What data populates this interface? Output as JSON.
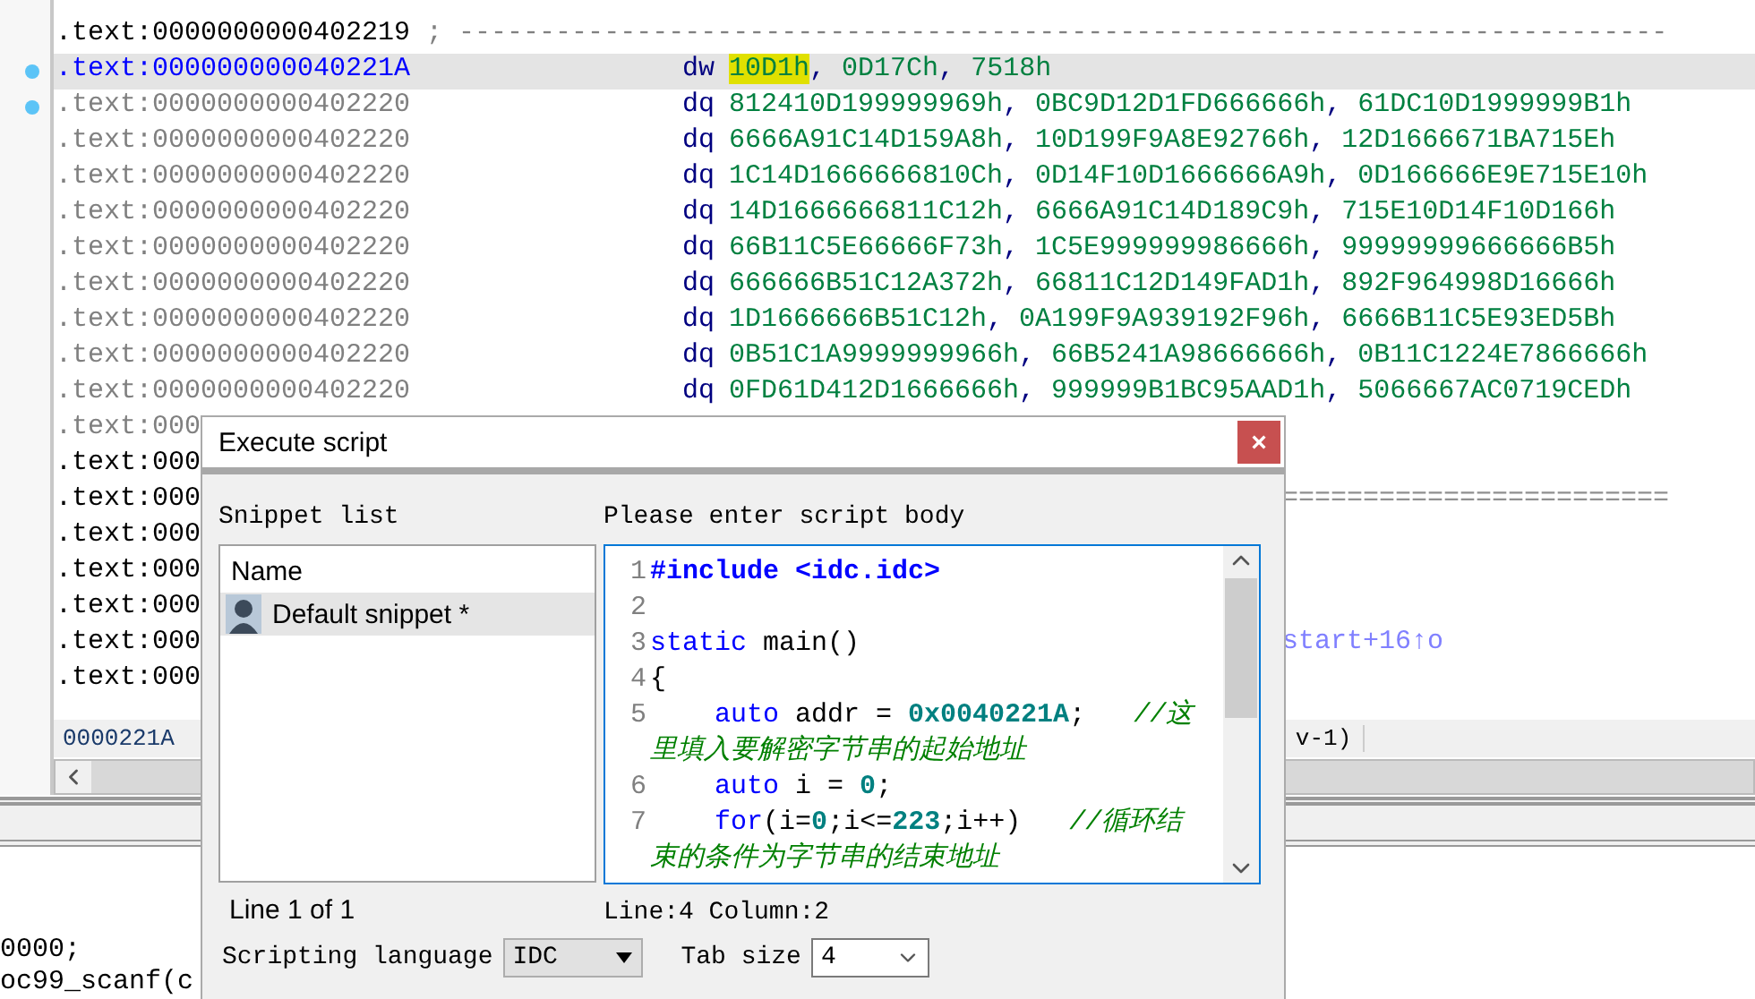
{
  "listing": {
    "rows": [
      {
        "address": ".text:0000000000402219",
        "kind": "code",
        "selected": false,
        "marker": false,
        "comment": "; ---------------------------------------------------------------------------"
      },
      {
        "address": ".text:000000000040221A",
        "kind": "code",
        "selected": true,
        "marker": true,
        "mnemonic": "dw",
        "operands": [
          "10D1h",
          ", ",
          "0D17Ch",
          ", ",
          "7518h"
        ],
        "cursor_on_first": true
      },
      {
        "address": ".text:0000000000402220",
        "kind": "data",
        "selected": false,
        "marker": true,
        "mnemonic": "dq",
        "operands": [
          "812410D199999969h",
          ", ",
          "0BC9D12D1FD666666h",
          ", ",
          "61DC10D1999999B1h"
        ],
        "cursor_on_first": false
      },
      {
        "address": ".text:0000000000402220",
        "kind": "data",
        "selected": false,
        "marker": false,
        "mnemonic": "dq",
        "operands": [
          "6666A91C14D159A8h",
          ", ",
          "10D199F9A8E92766h",
          ", ",
          "12D1666671BA715Eh"
        ],
        "cursor_on_first": false
      },
      {
        "address": ".text:0000000000402220",
        "kind": "data",
        "selected": false,
        "marker": false,
        "mnemonic": "dq",
        "operands": [
          "1C14D1666666810Ch",
          ", ",
          "0D14F10D1666666A9h",
          ", ",
          "0D166666E9E715E10h"
        ],
        "cursor_on_first": false
      },
      {
        "address": ".text:0000000000402220",
        "kind": "data",
        "selected": false,
        "marker": false,
        "mnemonic": "dq",
        "operands": [
          "14D1666666811C12h",
          ", ",
          "6666A91C14D189C9h",
          ", ",
          "715E10D14F10D166h"
        ],
        "cursor_on_first": false
      },
      {
        "address": ".text:0000000000402220",
        "kind": "data",
        "selected": false,
        "marker": false,
        "mnemonic": "dq",
        "operands": [
          "66B11C5E66666F73h",
          ", ",
          "1C5E999999986666h",
          ", ",
          "99999999666666B5h"
        ],
        "cursor_on_first": false
      },
      {
        "address": ".text:0000000000402220",
        "kind": "data",
        "selected": false,
        "marker": false,
        "mnemonic": "dq",
        "operands": [
          "666666B51C12A372h",
          ", ",
          "66811C12D149FAD1h",
          ", ",
          "892F964998D16666h"
        ],
        "cursor_on_first": false
      },
      {
        "address": ".text:0000000000402220",
        "kind": "data",
        "selected": false,
        "marker": false,
        "mnemonic": "dq",
        "operands": [
          "1D1666666B51C12h",
          ", ",
          "0A199F9A939192F96h",
          ", ",
          "6666B11C5E93ED5Bh"
        ],
        "cursor_on_first": false
      },
      {
        "address": ".text:0000000000402220",
        "kind": "data",
        "selected": false,
        "marker": false,
        "mnemonic": "dq",
        "operands": [
          "0B51C1A9999999966h",
          ", ",
          "66B5241A98666666h",
          ", ",
          "0B11C1224E7866666h"
        ],
        "cursor_on_first": false
      },
      {
        "address": ".text:0000000000402220",
        "kind": "data",
        "selected": false,
        "marker": false,
        "mnemonic": "dq",
        "operands": [
          "0FD61D412D1666666h",
          ", ",
          "999999B1BC95AAD1h",
          ", ",
          "5066667AC0719CEDh"
        ],
        "cursor_on_first": false
      },
      {
        "address": ".text:000",
        "kind": "data",
        "selected": false,
        "marker": false
      },
      {
        "address": ".text:000",
        "kind": "code",
        "selected": false,
        "marker": false
      },
      {
        "address": ".text:000",
        "kind": "code",
        "selected": false,
        "marker": false,
        "tail": {
          "text": "========================",
          "kind": "separator"
        }
      },
      {
        "address": ".text:000",
        "kind": "code",
        "selected": false,
        "marker": false
      },
      {
        "address": ".text:000",
        "kind": "code",
        "selected": false,
        "marker": false
      },
      {
        "address": ".text:000",
        "kind": "code",
        "selected": false,
        "marker": false
      },
      {
        "address": ".text:000",
        "kind": "code",
        "selected": false,
        "marker": false,
        "tail": {
          "text": "start+16↑o",
          "kind": "xref"
        }
      },
      {
        "address": ".text:000",
        "kind": "code",
        "selected": false,
        "marker": false
      }
    ]
  },
  "status_bar": {
    "address": "0000221A",
    "tail": "v-1)"
  },
  "lower_panel": {
    "lines": [
      "0000;",
      "oc99_scanf(c"
    ]
  },
  "dialog": {
    "title": "Execute script",
    "close": "×",
    "snippet_label": "Snippet list",
    "body_label": "Please enter script body",
    "snippet_header": "Name",
    "snippets": [
      {
        "name": "Default snippet *",
        "selected": true
      }
    ],
    "snippet_status": "Line 1 of 1",
    "code_lines": [
      {
        "number": "1",
        "tokens": [
          {
            "text": "#include <idc.idc>",
            "kind": "directive"
          }
        ]
      },
      {
        "number": "2"
      },
      {
        "number": "3",
        "tokens": [
          {
            "text": "static",
            "kind": "keyword"
          },
          {
            "text": " main()",
            "kind": "plain"
          }
        ]
      },
      {
        "number": "4",
        "tokens": [
          {
            "text": "{",
            "kind": "plain"
          }
        ]
      },
      {
        "number": "5",
        "tokens": [
          {
            "text": "    auto",
            "kind": "keyword"
          },
          {
            "text": " addr = ",
            "kind": "plain"
          },
          {
            "text": "0x0040221A",
            "kind": "number"
          },
          {
            "text": ";   ",
            "kind": "plain"
          },
          {
            "text": "//这里填入要解密字节串的起始地址",
            "kind": "comment"
          }
        ]
      },
      {
        "number": "6",
        "tokens": [
          {
            "text": "    auto",
            "kind": "keyword"
          },
          {
            "text": " i = ",
            "kind": "plain"
          },
          {
            "text": "0",
            "kind": "number"
          },
          {
            "text": ";",
            "kind": "plain"
          }
        ]
      },
      {
        "number": "7",
        "tokens": [
          {
            "text": "    for",
            "kind": "keyword"
          },
          {
            "text": "(i=",
            "kind": "plain"
          },
          {
            "text": "0",
            "kind": "number"
          },
          {
            "text": ";i<=",
            "kind": "plain"
          },
          {
            "text": "223",
            "kind": "number"
          },
          {
            "text": ";i++)   ",
            "kind": "plain"
          },
          {
            "text": "//循环结束的条件为字节串的结束地址",
            "kind": "comment"
          }
        ]
      }
    ],
    "cursor_status": "Line:4  Column:2",
    "language_label": "Scripting language",
    "language": "IDC",
    "tab_label": "Tab size",
    "tab_size": "4"
  }
}
